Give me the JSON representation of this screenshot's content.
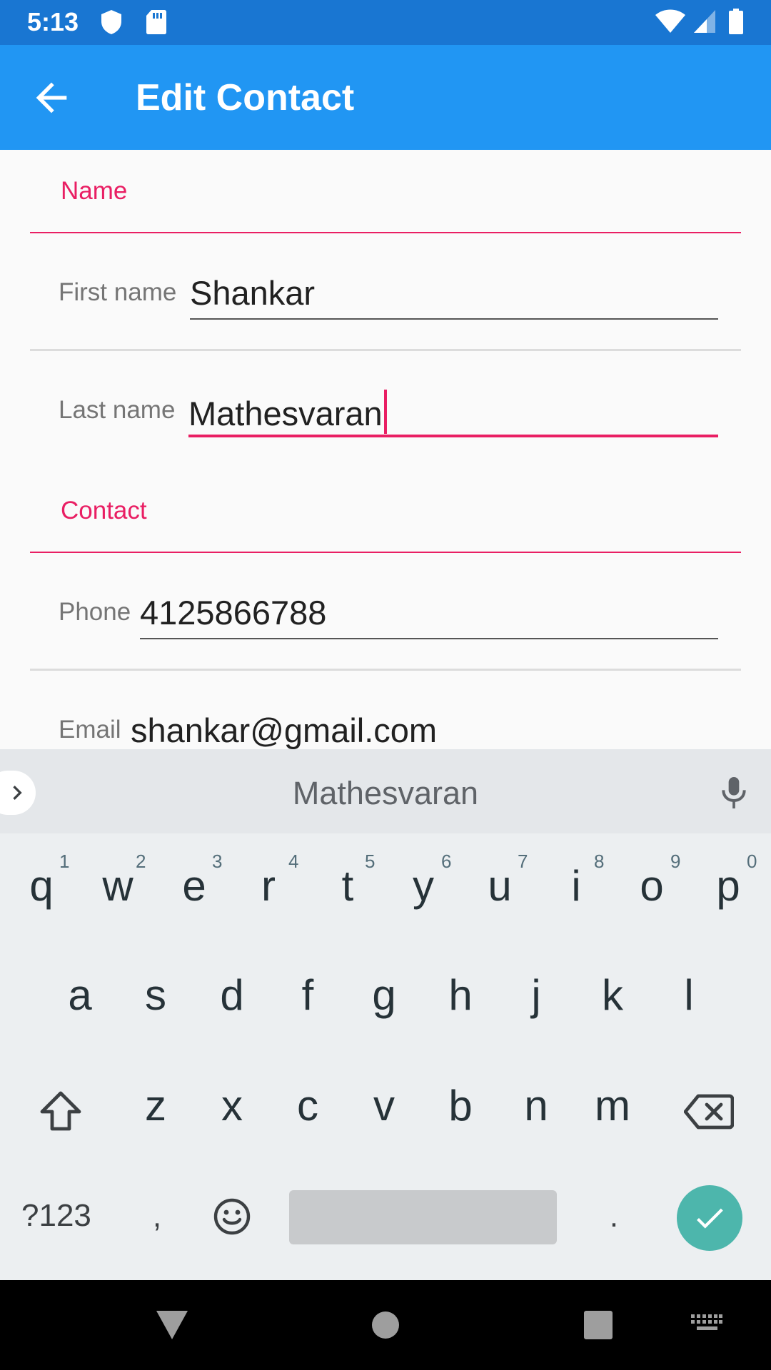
{
  "status_bar": {
    "time": "5:13",
    "left_icons": [
      "shield-icon",
      "sd-card-icon"
    ],
    "right_icons": [
      "wifi-icon",
      "cell-signal-icon",
      "battery-icon"
    ],
    "color": "#1976d2"
  },
  "app_bar": {
    "title": "Edit Contact",
    "back_icon": "arrow-back-icon",
    "color": "#2196f3"
  },
  "form": {
    "sections": [
      {
        "header": "Name",
        "fields": [
          {
            "label": "First name",
            "value": "Shankar",
            "focused": false
          },
          {
            "label": "Last name",
            "value": "Mathesvaran",
            "focused": true
          }
        ]
      },
      {
        "header": "Contact",
        "fields": [
          {
            "label": "Phone",
            "value": "4125866788",
            "focused": false
          },
          {
            "label": "Email",
            "value": "shankar@gmail.com",
            "focused": false
          }
        ]
      }
    ],
    "accent_color": "#e91e63"
  },
  "keyboard": {
    "suggestion": "Mathesvaran",
    "row1": [
      "q",
      "w",
      "e",
      "r",
      "t",
      "y",
      "u",
      "i",
      "o",
      "p"
    ],
    "row1_hints": [
      "1",
      "2",
      "3",
      "4",
      "5",
      "6",
      "7",
      "8",
      "9",
      "0"
    ],
    "row2": [
      "a",
      "s",
      "d",
      "f",
      "g",
      "h",
      "j",
      "k",
      "l"
    ],
    "row3": [
      "z",
      "x",
      "c",
      "v",
      "b",
      "n",
      "m"
    ],
    "symbols_label": "?123",
    "comma": ",",
    "period": ".",
    "special_icons": [
      "expand-arrow-icon",
      "mic-icon",
      "shift-icon",
      "backspace-icon",
      "emoji-icon",
      "check-icon"
    ],
    "done_color": "#4db6ac"
  },
  "nav_bar": {
    "icons": [
      "back-triangle-icon",
      "home-circle-icon",
      "recents-square-icon",
      "keyboard-switch-icon"
    ]
  }
}
